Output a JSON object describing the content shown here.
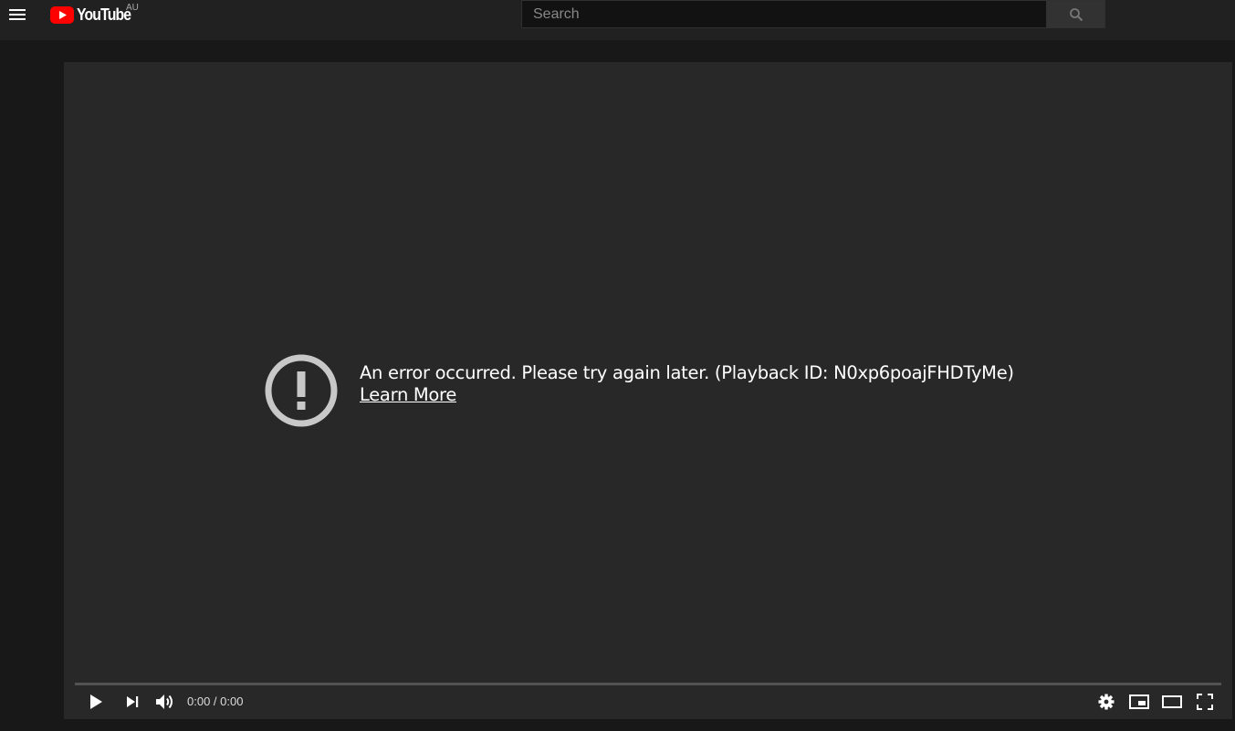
{
  "masthead": {
    "menu_icon": "hamburger-menu-icon",
    "logo": {
      "wordmark": "YouTube",
      "country": "AU",
      "brand_color": "#ff0000"
    },
    "search": {
      "placeholder": "Search",
      "value": "",
      "button_icon": "search-icon"
    }
  },
  "player": {
    "error": {
      "icon": "exclamation-circle-icon",
      "message": "An error occurred. Please try again later. (Playback ID: N0xp6poajFHDTyMe)",
      "link_label": "Learn More"
    },
    "progress": 0,
    "controls": {
      "play_icon": "play-icon",
      "next_icon": "next-icon",
      "volume_icon": "volume-icon",
      "time": "0:00 / 0:00",
      "settings_icon": "gear-icon",
      "miniplayer_icon": "miniplayer-icon",
      "theater_icon": "theater-mode-icon",
      "fullscreen_icon": "fullscreen-icon"
    }
  },
  "colors": {
    "background": "#181818",
    "masthead": "#212121",
    "player": "#282828",
    "error_icon": "#c8c8c8"
  }
}
